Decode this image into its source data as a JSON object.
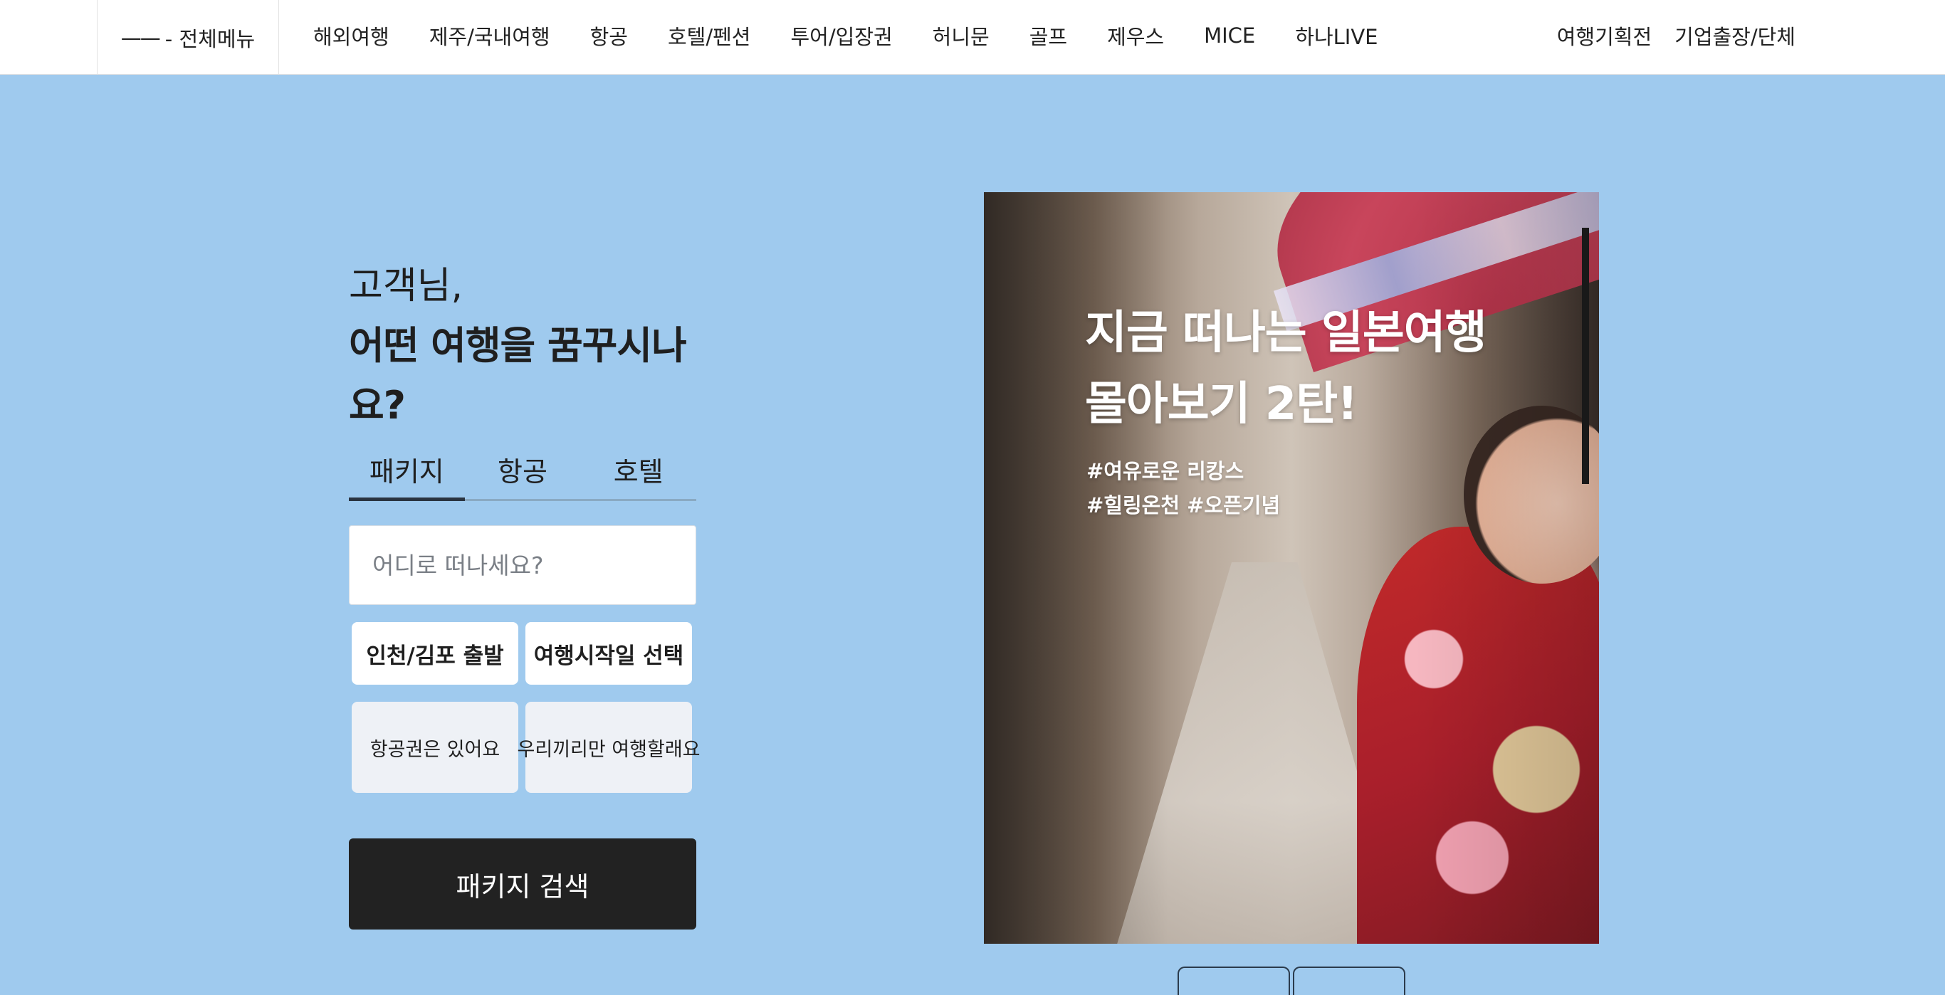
{
  "header": {
    "all_menu": {
      "icon": "hamburger-icon",
      "glyph": "——",
      "label": "- 전체메뉴"
    },
    "main_nav": [
      "해외여행",
      "제주/국내여행",
      "항공",
      "호텔/펜션",
      "투어/입장권",
      "허니문",
      "골프",
      "제우스",
      "MICE",
      "하나LIVE"
    ],
    "sub_nav": [
      "여행기획전",
      "기업출장/단체"
    ]
  },
  "search": {
    "greeting_line1": "고객님,",
    "greeting_line2": "어떤 여행을 꿈꾸시나요?",
    "tabs": [
      {
        "label": "패키지",
        "active": true
      },
      {
        "label": "항공",
        "active": false
      },
      {
        "label": "호텔",
        "active": false
      }
    ],
    "destination_placeholder": "어디로 떠나세요?",
    "departure_button": "인천/김포 출발",
    "date_button": "여행시작일 선택",
    "toggle_have_ticket": "항공권은 있어요",
    "toggle_private": "우리끼리만 여행할래요",
    "submit_label": "패키지 검색"
  },
  "banner": {
    "title_line1": "지금 떠나는 일본여행",
    "title_line2": "몰아보기 2탄!",
    "tags_line1": "#여유로운 리캉스",
    "tags_line2": "#힐링온천 #오픈기념"
  },
  "colors": {
    "background": "#9fcaee",
    "search_button": "#222222",
    "toggle_bg": "#eef1f6",
    "tab_indicator": "#2a3440"
  }
}
